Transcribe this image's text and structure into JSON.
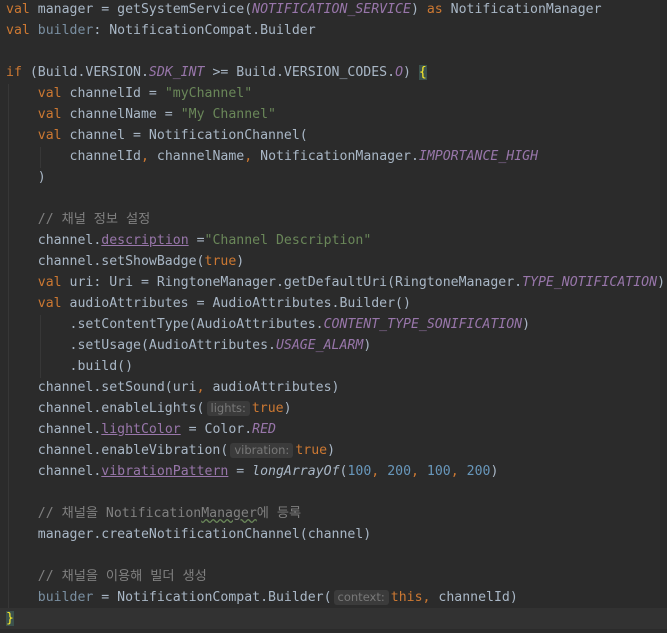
{
  "editor": {
    "lines": [
      [
        [
          "kw",
          "val "
        ],
        [
          "idt",
          "manager = getSystemService("
        ],
        [
          "cst",
          "NOTIFICATION_SERVICE"
        ],
        [
          "idt",
          ") "
        ],
        [
          "kw",
          "as "
        ],
        [
          "idt",
          "NotificationManager"
        ]
      ],
      [
        [
          "kw",
          "val "
        ],
        [
          "dim",
          "builder"
        ],
        [
          "idt",
          ": NotificationCompat.Builder"
        ]
      ],
      [],
      [
        [
          "kw",
          "if "
        ],
        [
          "idt",
          "(Build.VERSION."
        ],
        [
          "cst",
          "SDK_INT"
        ],
        [
          "idt",
          " >= Build.VERSION_CODES."
        ],
        [
          "cst",
          "O"
        ],
        [
          "idt",
          ") "
        ],
        [
          "brace",
          "{"
        ]
      ],
      [
        [
          "sp",
          "    "
        ],
        [
          "kw",
          "val "
        ],
        [
          "idt",
          "channelId = "
        ],
        [
          "str",
          "\"myChannel\""
        ]
      ],
      [
        [
          "sp",
          "    "
        ],
        [
          "kw",
          "val "
        ],
        [
          "idt",
          "channelName = "
        ],
        [
          "str",
          "\"My Channel\""
        ]
      ],
      [
        [
          "sp",
          "    "
        ],
        [
          "kw",
          "val "
        ],
        [
          "idt",
          "channel = NotificationChannel("
        ]
      ],
      [
        [
          "sp",
          "        "
        ],
        [
          "idt",
          "channelId"
        ],
        [
          "kw",
          ", "
        ],
        [
          "idt",
          "channelName"
        ],
        [
          "kw",
          ", "
        ],
        [
          "idt",
          "NotificationManager."
        ],
        [
          "cst",
          "IMPORTANCE_HIGH"
        ]
      ],
      [
        [
          "sp",
          "    "
        ],
        [
          "idt",
          ")"
        ]
      ],
      [],
      [
        [
          "sp",
          "    "
        ],
        [
          "cmt",
          "// 채널 정보 설정"
        ]
      ],
      [
        [
          "sp",
          "    "
        ],
        [
          "idt",
          "channel."
        ],
        [
          "prp",
          "description"
        ],
        [
          "idt",
          " ="
        ],
        [
          "str",
          "\"Channel Description\""
        ]
      ],
      [
        [
          "sp",
          "    "
        ],
        [
          "idt",
          "channel.setShowBadge("
        ],
        [
          "kw",
          "true"
        ],
        [
          "idt",
          ")"
        ]
      ],
      [
        [
          "sp",
          "    "
        ],
        [
          "kw",
          "val "
        ],
        [
          "idt",
          "uri: Uri = RingtoneManager.getDefaultUri(RingtoneManager."
        ],
        [
          "cst",
          "TYPE_NOTIFICATION"
        ],
        [
          "idt",
          ")"
        ]
      ],
      [
        [
          "sp",
          "    "
        ],
        [
          "kw",
          "val "
        ],
        [
          "idt",
          "audioAttributes = AudioAttributes.Builder()"
        ]
      ],
      [
        [
          "sp",
          "        "
        ],
        [
          "idt",
          ".setContentType(AudioAttributes."
        ],
        [
          "cst",
          "CONTENT_TYPE_SONIFICATION"
        ],
        [
          "idt",
          ")"
        ]
      ],
      [
        [
          "sp",
          "        "
        ],
        [
          "idt",
          ".setUsage(AudioAttributes."
        ],
        [
          "cst",
          "USAGE_ALARM"
        ],
        [
          "idt",
          ")"
        ]
      ],
      [
        [
          "sp",
          "        "
        ],
        [
          "idt",
          ".build()"
        ]
      ],
      [
        [
          "sp",
          "    "
        ],
        [
          "idt",
          "channel.setSound(uri"
        ],
        [
          "kw",
          ", "
        ],
        [
          "idt",
          "audioAttributes)"
        ]
      ],
      [
        [
          "sp",
          "    "
        ],
        [
          "idt",
          "channel.enableLights("
        ],
        [
          "hint",
          "lights:"
        ],
        [
          "kw",
          "true"
        ],
        [
          "idt",
          ")"
        ]
      ],
      [
        [
          "sp",
          "    "
        ],
        [
          "idt",
          "channel."
        ],
        [
          "prp",
          "lightColor"
        ],
        [
          "idt",
          " = Color."
        ],
        [
          "cst",
          "RED"
        ]
      ],
      [
        [
          "sp",
          "    "
        ],
        [
          "idt",
          "channel.enableVibration("
        ],
        [
          "hint",
          "vibration:"
        ],
        [
          "kw",
          "true"
        ],
        [
          "idt",
          ")"
        ]
      ],
      [
        [
          "sp",
          "    "
        ],
        [
          "idt",
          "channel."
        ],
        [
          "prp",
          "vibrationPattern"
        ],
        [
          "idt",
          " = "
        ],
        [
          "fni",
          "longArrayOf"
        ],
        [
          "idt",
          "("
        ],
        [
          "num",
          "100"
        ],
        [
          "kw",
          ", "
        ],
        [
          "num",
          "200"
        ],
        [
          "kw",
          ", "
        ],
        [
          "num",
          "100"
        ],
        [
          "kw",
          ", "
        ],
        [
          "num",
          "200"
        ],
        [
          "idt",
          ")"
        ]
      ],
      [],
      [
        [
          "sp",
          "    "
        ],
        [
          "cmt",
          "// 채널을 Notification"
        ],
        [
          "cmtsq",
          "Manager"
        ],
        [
          "cmt",
          "에 등록"
        ]
      ],
      [
        [
          "sp",
          "    "
        ],
        [
          "idt",
          "manager.createNotificationChannel(channel)"
        ]
      ],
      [],
      [
        [
          "sp",
          "    "
        ],
        [
          "cmt",
          "// 채널을 이용해 빌더 생성"
        ]
      ],
      [
        [
          "sp",
          "    "
        ],
        [
          "dim",
          "builder"
        ],
        [
          "idt",
          " = NotificationCompat.Builder("
        ],
        [
          "hint",
          "context:"
        ],
        [
          "kw",
          "this"
        ],
        [
          "kw",
          ", "
        ],
        [
          "idt",
          "channelId)"
        ]
      ],
      [
        [
          "brace",
          "}"
        ]
      ]
    ],
    "current_line": 29,
    "colors": {
      "background": "#2b2b2b",
      "keyword": "#cc7832",
      "string": "#6a8759",
      "number": "#6897bb",
      "constant": "#9876aa",
      "comment": "#808080"
    }
  }
}
